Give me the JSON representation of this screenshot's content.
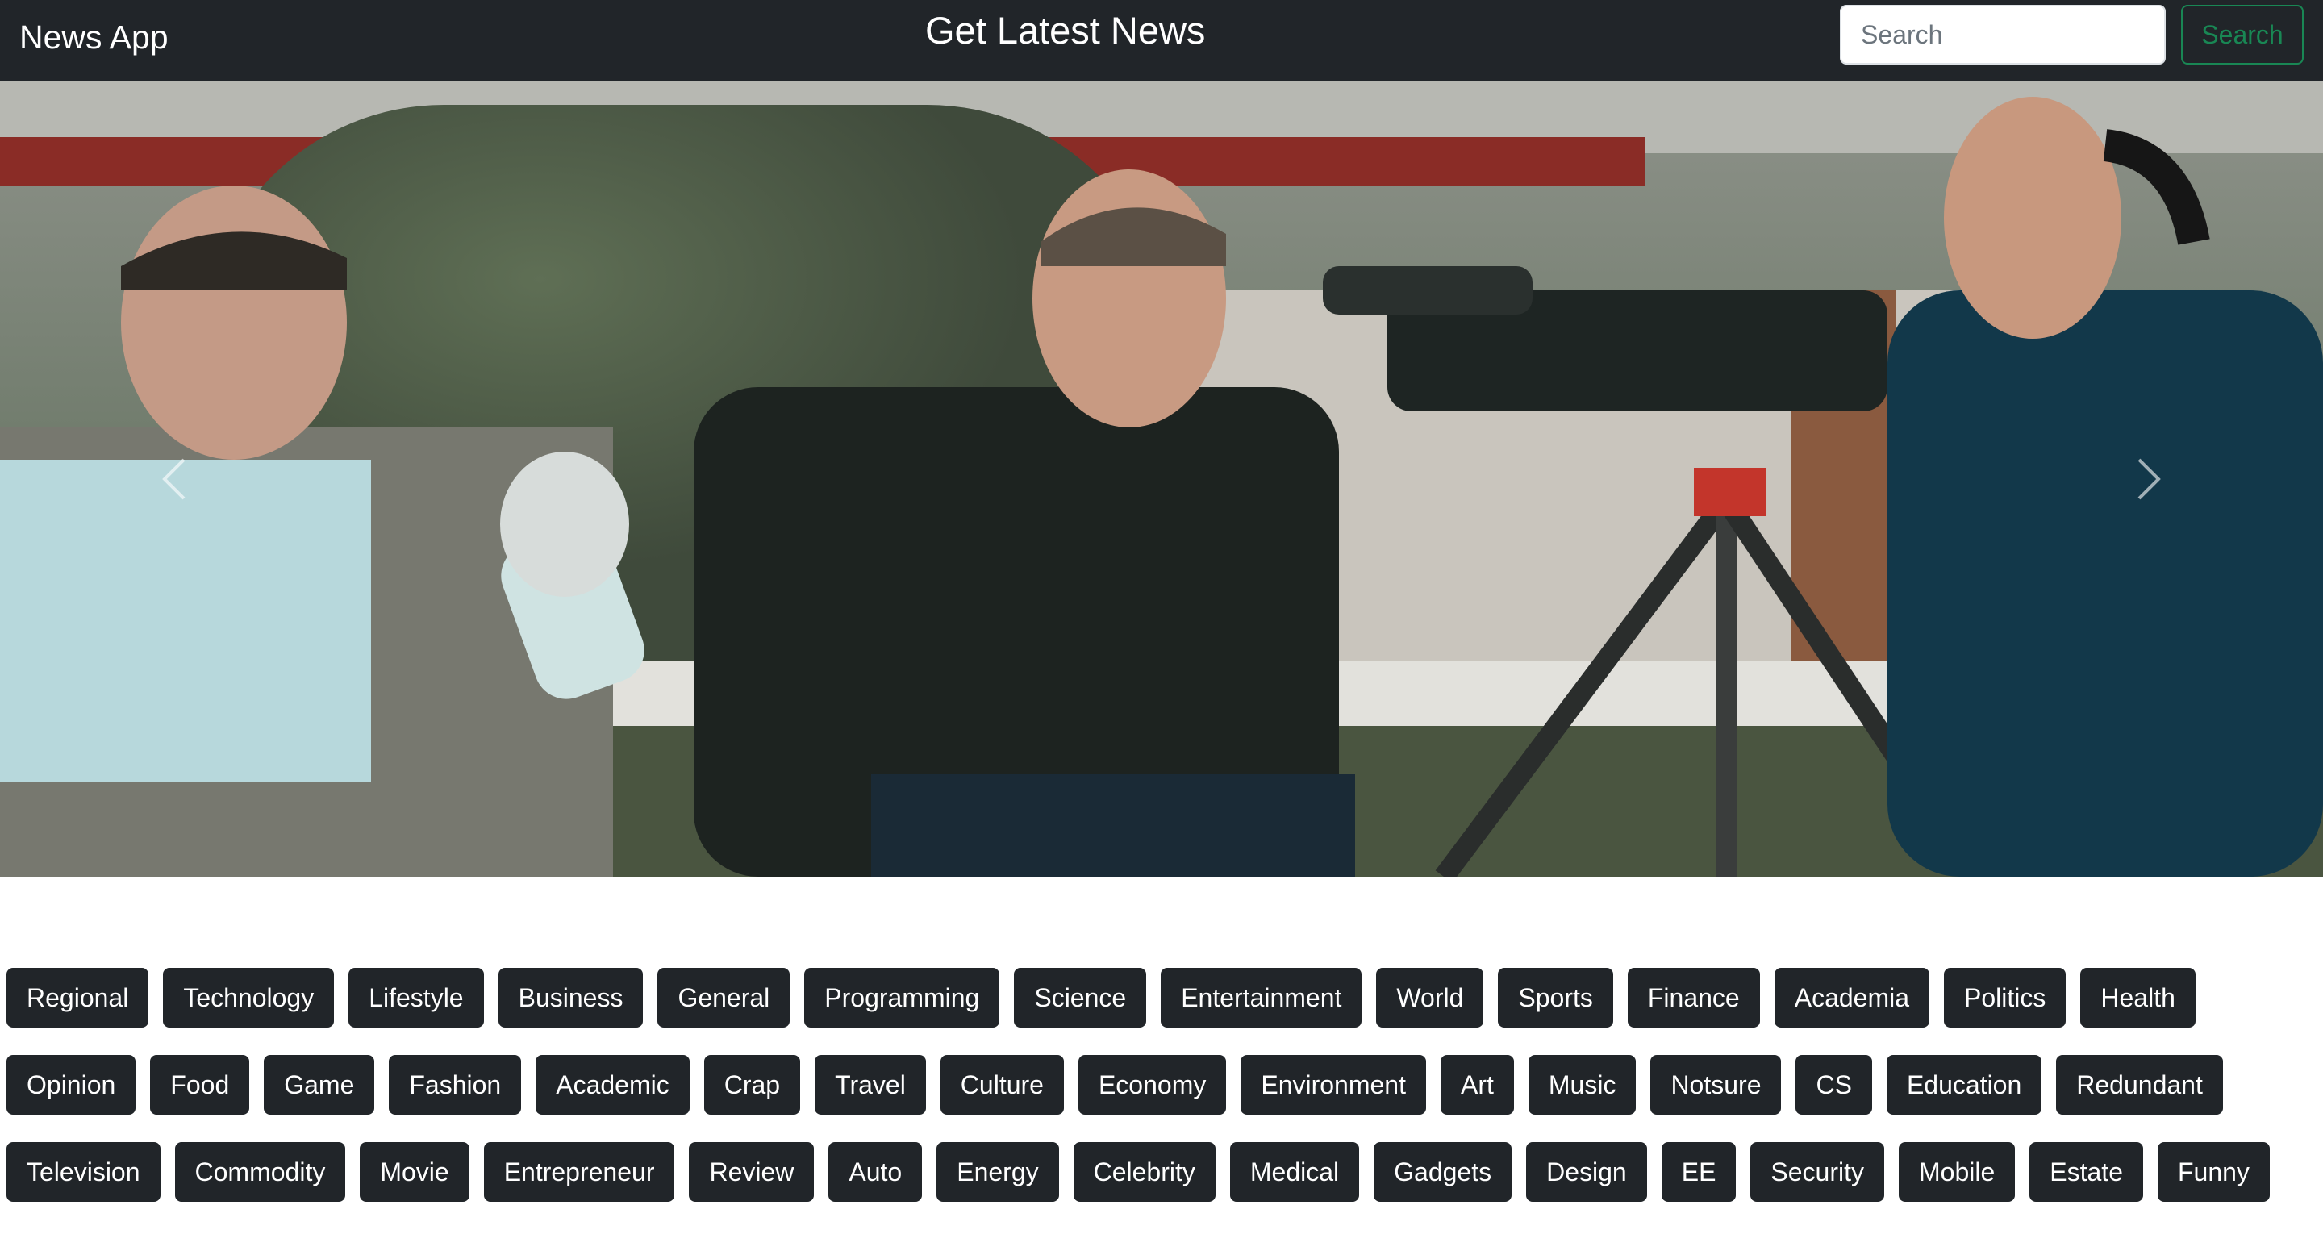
{
  "navbar": {
    "brand": "News App",
    "headline": "Get Latest News",
    "search_placeholder": "Search",
    "search_button": "Search"
  },
  "carousel": {
    "image_alt": "News crew filming an interview",
    "prev_icon": "chevron-left-icon",
    "next_icon": "chevron-right-icon"
  },
  "categories": {
    "row1": [
      "Regional",
      "Technology",
      "Lifestyle",
      "Business",
      "General",
      "Programming",
      "Science",
      "Entertainment",
      "World",
      "Sports",
      "Finance",
      "Academia",
      "Politics",
      "Health"
    ],
    "row2": [
      "Opinion",
      "Food",
      "Game",
      "Fashion",
      "Academic",
      "Crap",
      "Travel",
      "Culture",
      "Economy",
      "Environment",
      "Art",
      "Music",
      "Notsure",
      "CS",
      "Education",
      "Redundant"
    ],
    "row3": [
      "Television",
      "Commodity",
      "Movie",
      "Entrepreneur",
      "Review",
      "Auto",
      "Energy",
      "Celebrity",
      "Medical",
      "Gadgets",
      "Design",
      "EE",
      "Security",
      "Mobile",
      "Estate",
      "Funny"
    ]
  },
  "colors": {
    "navbar_bg": "#212529",
    "success": "#198754",
    "chip_bg": "#212529"
  }
}
